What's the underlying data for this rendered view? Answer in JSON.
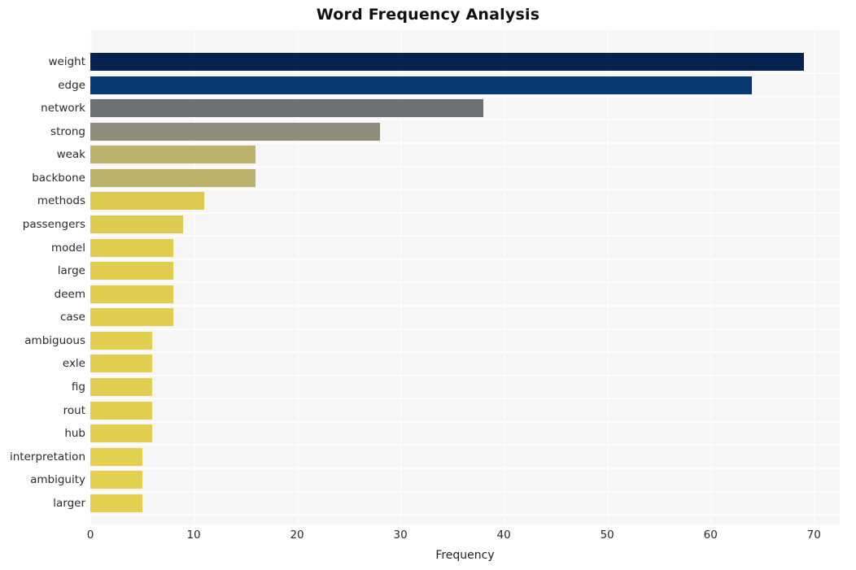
{
  "chart_data": {
    "type": "bar",
    "orientation": "horizontal",
    "title": "Word Frequency Analysis",
    "xlabel": "Frequency",
    "ylabel": "",
    "xlim": [
      0,
      72.5
    ],
    "xticks": [
      0,
      10,
      20,
      30,
      40,
      50,
      60,
      70
    ],
    "xtick_labels": [
      "0",
      "10",
      "20",
      "30",
      "40",
      "50",
      "60",
      "70"
    ],
    "grid": true,
    "grid_axis": "both",
    "legend": "none",
    "categories": [
      "weight",
      "edge",
      "network",
      "strong",
      "weak",
      "backbone",
      "methods",
      "passengers",
      "model",
      "large",
      "deem",
      "case",
      "ambiguous",
      "exle",
      "fig",
      "rout",
      "hub",
      "interpretation",
      "ambiguity",
      "larger"
    ],
    "values": [
      69,
      64,
      38,
      28,
      16,
      16,
      11,
      9,
      8,
      8,
      8,
      8,
      6,
      6,
      6,
      6,
      6,
      5,
      5,
      5
    ],
    "bar_colors": [
      "#06234f",
      "#083a72",
      "#6f7073",
      "#8e8d7c",
      "#bdb26c",
      "#bdb26c",
      "#ddcb51",
      "#ddcb51",
      "#e0cd50",
      "#e0cd50",
      "#e0cd50",
      "#e0cd50",
      "#e2ce50",
      "#e2ce50",
      "#e2ce50",
      "#e2ce50",
      "#e2ce50",
      "#e3cf50",
      "#e3cf50",
      "#e3cf50"
    ]
  },
  "style": {
    "plot_background": "#f6f6f7",
    "page_background": "#ffffff",
    "grid_color": "#fbfbfb",
    "title_color": "#111111",
    "tick_color": "#2a2a2a"
  }
}
